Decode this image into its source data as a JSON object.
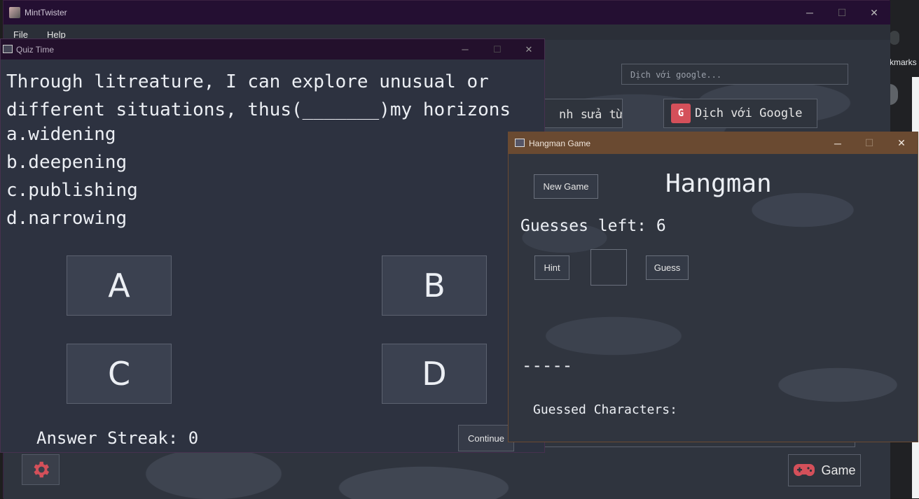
{
  "browser": {
    "bookmarks_label": "kmarks"
  },
  "main_window": {
    "title": "MintTwister",
    "menu": [
      "File",
      "Help"
    ],
    "search_placeholder": "Dịch với google...",
    "edit_word_label": "nh sửa từ",
    "translate_label": "Dịch với Google",
    "translate_icon_text": "G",
    "game_label": "Game",
    "controls": {
      "minimize": "─",
      "maximize": "☐",
      "close": "✕"
    }
  },
  "quiz_window": {
    "title": "Quiz Time",
    "question_line1": "Through litreature, I can explore unusual or",
    "question_line2": "different situations, thus(_______)my horizons",
    "options": [
      "a.widening",
      "b.deepening",
      "c.publishing",
      "d.narrowing"
    ],
    "answer_buttons": [
      "A",
      "B",
      "C",
      "D"
    ],
    "streak_text": "Answer Streak: 0",
    "continue_label": "Continue"
  },
  "hangman_window": {
    "title": "Hangman Game",
    "new_game_label": "New Game",
    "heading": "Hangman",
    "guesses_left_text": "Guesses left: 6",
    "hint_label": "Hint",
    "guess_label": "Guess",
    "guess_value": "",
    "word_blanks": "-----",
    "guessed_characters_label": "Guessed Characters:"
  },
  "colors": {
    "main_titlebar": "#240f32",
    "hangman_titlebar": "#6a4a31",
    "accent_icon": "#d4505a"
  }
}
